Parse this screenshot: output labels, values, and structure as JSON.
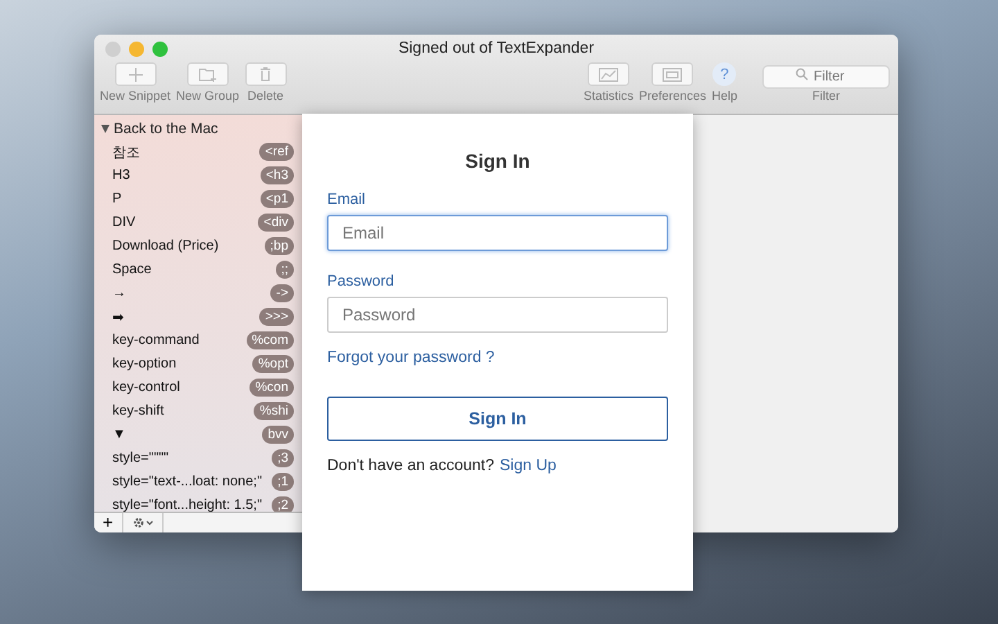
{
  "window": {
    "title": "Signed out of TextExpander"
  },
  "toolbar": {
    "left": [
      {
        "label": "New Snippet",
        "kind": "plus"
      },
      {
        "label": "New Group",
        "kind": "folder"
      },
      {
        "label": "Delete",
        "kind": "trash"
      }
    ],
    "right": [
      {
        "label": "Statistics",
        "kind": "chart"
      },
      {
        "label": "Preferences",
        "kind": "prefs"
      },
      {
        "label": "Help",
        "kind": "help",
        "symbol": "?"
      }
    ],
    "filter": {
      "placeholder": "Filter",
      "label": "Filter"
    }
  },
  "sidebar": {
    "group": {
      "label": "Back to the Mac",
      "expanded": true,
      "children": [
        {
          "label": "참조",
          "abbreviation": "<ref"
        },
        {
          "label": "H3",
          "abbreviation": "<h3"
        },
        {
          "label": "P",
          "abbreviation": "<p1"
        },
        {
          "label": "DIV",
          "abbreviation": "<div"
        },
        {
          "label": "Download (Price)",
          "abbreviation": ";bp"
        },
        {
          "label": "Space",
          "abbreviation": ";;"
        },
        {
          "label": "→",
          "abbreviation": "->"
        },
        {
          "label": "➡",
          "abbreviation": ">>>"
        },
        {
          "label": "key-command",
          "abbreviation": "%com"
        },
        {
          "label": "key-option",
          "abbreviation": "%opt"
        },
        {
          "label": "key-control",
          "abbreviation": "%con"
        },
        {
          "label": "key-shift",
          "abbreviation": "%shi"
        },
        {
          "label": "▼",
          "abbreviation": "bvv"
        },
        {
          "label": "style=\"\"\"\"",
          "abbreviation": ";3"
        },
        {
          "label": "style=\"text-...loat: none;\"",
          "abbreviation": ";1"
        },
        {
          "label": "style=\"font...height: 1.5;\"",
          "abbreviation": ";2"
        }
      ]
    }
  },
  "bottom_bar": {
    "add": "+"
  },
  "sign_in": {
    "title": "Sign In",
    "email_label": "Email",
    "email": {
      "placeholder": "Email",
      "focused": true
    },
    "password_label": "Password",
    "password": {
      "placeholder": "Password",
      "focused": false
    },
    "forgot": "Forgot your password ?",
    "button": "Sign In",
    "prompt": "Don't have an account?",
    "signup": "Sign Up"
  }
}
